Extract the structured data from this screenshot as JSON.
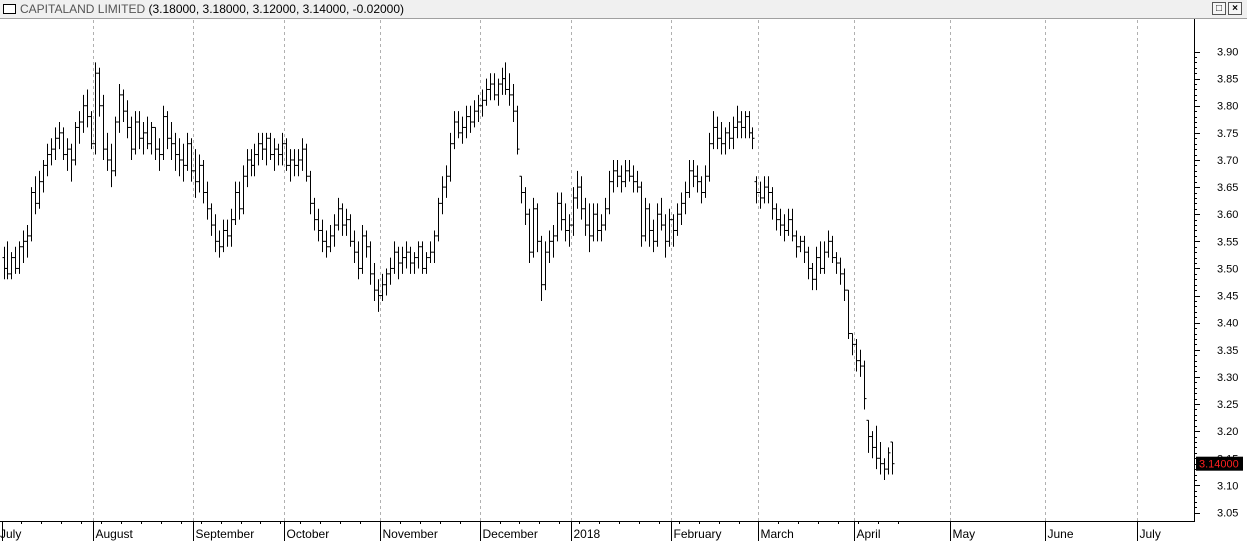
{
  "window": {
    "symbol": "CAPITALAND LIMITED",
    "ohlc": "(3.18000, 3.18000, 3.12000, 3.14000, -0.02000)"
  },
  "chart_data": {
    "type": "ohlc",
    "title": "CAPITALAND LIMITED",
    "xlabel": "",
    "ylabel": "",
    "ylim": [
      3.03,
      3.93
    ],
    "y_ticks": [
      "3.05",
      "3.10",
      "3.15",
      "3.20",
      "3.25",
      "3.30",
      "3.35",
      "3.40",
      "3.45",
      "3.50",
      "3.55",
      "3.60",
      "3.65",
      "3.70",
      "3.75",
      "3.80",
      "3.85",
      "3.90"
    ],
    "x_labels": [
      {
        "label": "July",
        "bar": 0
      },
      {
        "label": "August",
        "bar": 23
      },
      {
        "label": "September",
        "bar": 48
      },
      {
        "label": "October",
        "bar": 71
      },
      {
        "label": "November",
        "bar": 95
      },
      {
        "label": "December",
        "bar": 120
      },
      {
        "label": "2018",
        "bar": 143
      },
      {
        "label": "February",
        "bar": 168
      },
      {
        "label": "March",
        "bar": 190
      },
      {
        "label": "April",
        "bar": 214
      },
      {
        "label": "May",
        "bar": 238
      },
      {
        "label": "June",
        "bar": 262
      },
      {
        "label": "July",
        "bar": 285
      }
    ],
    "grid": {
      "vertical": true,
      "horizontal": false
    },
    "last_price": "3.14000",
    "bars": [
      [
        3.52,
        3.54,
        3.48,
        3.5
      ],
      [
        3.5,
        3.55,
        3.48,
        3.49
      ],
      [
        3.49,
        3.53,
        3.48,
        3.52
      ],
      [
        3.52,
        3.54,
        3.49,
        3.5
      ],
      [
        3.5,
        3.55,
        3.49,
        3.54
      ],
      [
        3.54,
        3.57,
        3.51,
        3.55
      ],
      [
        3.55,
        3.58,
        3.52,
        3.56
      ],
      [
        3.56,
        3.65,
        3.55,
        3.64
      ],
      [
        3.64,
        3.67,
        3.6,
        3.62
      ],
      [
        3.62,
        3.68,
        3.61,
        3.66
      ],
      [
        3.66,
        3.7,
        3.64,
        3.69
      ],
      [
        3.69,
        3.73,
        3.67,
        3.71
      ],
      [
        3.71,
        3.74,
        3.69,
        3.72
      ],
      [
        3.72,
        3.76,
        3.7,
        3.74
      ],
      [
        3.74,
        3.77,
        3.72,
        3.75
      ],
      [
        3.75,
        3.76,
        3.7,
        3.71
      ],
      [
        3.71,
        3.74,
        3.68,
        3.72
      ],
      [
        3.72,
        3.73,
        3.66,
        3.7
      ],
      [
        3.7,
        3.77,
        3.69,
        3.76
      ],
      [
        3.76,
        3.79,
        3.73,
        3.77
      ],
      [
        3.77,
        3.82,
        3.75,
        3.8
      ],
      [
        3.8,
        3.83,
        3.76,
        3.78
      ],
      [
        3.78,
        3.79,
        3.72,
        3.73
      ],
      [
        3.73,
        3.88,
        3.71,
        3.86
      ],
      [
        3.86,
        3.87,
        3.78,
        3.8
      ],
      [
        3.8,
        3.82,
        3.7,
        3.72
      ],
      [
        3.72,
        3.75,
        3.68,
        3.7
      ],
      [
        3.7,
        3.73,
        3.65,
        3.68
      ],
      [
        3.68,
        3.78,
        3.67,
        3.77
      ],
      [
        3.77,
        3.84,
        3.75,
        3.82
      ],
      [
        3.82,
        3.83,
        3.77,
        3.79
      ],
      [
        3.79,
        3.81,
        3.74,
        3.76
      ],
      [
        3.76,
        3.78,
        3.7,
        3.72
      ],
      [
        3.72,
        3.79,
        3.71,
        3.77
      ],
      [
        3.77,
        3.79,
        3.72,
        3.74
      ],
      [
        3.74,
        3.77,
        3.71,
        3.75
      ],
      [
        3.75,
        3.78,
        3.72,
        3.73
      ],
      [
        3.73,
        3.77,
        3.71,
        3.76
      ],
      [
        3.76,
        3.76,
        3.7,
        3.72
      ],
      [
        3.72,
        3.74,
        3.68,
        3.71
      ],
      [
        3.71,
        3.8,
        3.7,
        3.78
      ],
      [
        3.78,
        3.79,
        3.72,
        3.74
      ],
      [
        3.74,
        3.77,
        3.7,
        3.73
      ],
      [
        3.73,
        3.75,
        3.68,
        3.71
      ],
      [
        3.71,
        3.74,
        3.67,
        3.7
      ],
      [
        3.7,
        3.73,
        3.66,
        3.69
      ],
      [
        3.69,
        3.75,
        3.68,
        3.73
      ],
      [
        3.73,
        3.74,
        3.66,
        3.68
      ],
      [
        3.68,
        3.72,
        3.63,
        3.66
      ],
      [
        3.66,
        3.71,
        3.64,
        3.69
      ],
      [
        3.69,
        3.7,
        3.62,
        3.64
      ],
      [
        3.64,
        3.66,
        3.59,
        3.61
      ],
      [
        3.61,
        3.62,
        3.56,
        3.58
      ],
      [
        3.58,
        3.6,
        3.53,
        3.55
      ],
      [
        3.55,
        3.57,
        3.52,
        3.54
      ],
      [
        3.54,
        3.59,
        3.53,
        3.57
      ],
      [
        3.57,
        3.59,
        3.54,
        3.56
      ],
      [
        3.56,
        3.61,
        3.54,
        3.59
      ],
      [
        3.59,
        3.66,
        3.58,
        3.64
      ],
      [
        3.64,
        3.66,
        3.59,
        3.61
      ],
      [
        3.61,
        3.69,
        3.6,
        3.67
      ],
      [
        3.67,
        3.72,
        3.65,
        3.7
      ],
      [
        3.7,
        3.72,
        3.67,
        3.69
      ],
      [
        3.69,
        3.73,
        3.67,
        3.71
      ],
      [
        3.71,
        3.75,
        3.69,
        3.73
      ],
      [
        3.73,
        3.75,
        3.7,
        3.72
      ],
      [
        3.72,
        3.75,
        3.69,
        3.74
      ],
      [
        3.74,
        3.75,
        3.7,
        3.71
      ],
      [
        3.71,
        3.74,
        3.68,
        3.72
      ],
      [
        3.72,
        3.73,
        3.69,
        3.71
      ],
      [
        3.71,
        3.75,
        3.69,
        3.73
      ],
      [
        3.73,
        3.74,
        3.68,
        3.69
      ],
      [
        3.69,
        3.72,
        3.66,
        3.7
      ],
      [
        3.7,
        3.72,
        3.67,
        3.69
      ],
      [
        3.69,
        3.72,
        3.67,
        3.7
      ],
      [
        3.7,
        3.74,
        3.68,
        3.72
      ],
      [
        3.72,
        3.73,
        3.66,
        3.67
      ],
      [
        3.67,
        3.68,
        3.6,
        3.62
      ],
      [
        3.62,
        3.63,
        3.57,
        3.59
      ],
      [
        3.59,
        3.61,
        3.55,
        3.57
      ],
      [
        3.57,
        3.59,
        3.53,
        3.55
      ],
      [
        3.55,
        3.57,
        3.52,
        3.54
      ],
      [
        3.54,
        3.58,
        3.53,
        3.56
      ],
      [
        3.56,
        3.6,
        3.54,
        3.58
      ],
      [
        3.58,
        3.63,
        3.57,
        3.61
      ],
      [
        3.61,
        3.62,
        3.56,
        3.58
      ],
      [
        3.58,
        3.61,
        3.56,
        3.59
      ],
      [
        3.59,
        3.6,
        3.54,
        3.55
      ],
      [
        3.55,
        3.57,
        3.51,
        3.53
      ],
      [
        3.53,
        3.55,
        3.48,
        3.5
      ],
      [
        3.5,
        3.58,
        3.49,
        3.56
      ],
      [
        3.56,
        3.57,
        3.52,
        3.54
      ],
      [
        3.54,
        3.55,
        3.47,
        3.49
      ],
      [
        3.49,
        3.51,
        3.44,
        3.46
      ],
      [
        3.46,
        3.48,
        3.42,
        3.45
      ],
      [
        3.45,
        3.49,
        3.44,
        3.47
      ],
      [
        3.47,
        3.5,
        3.45,
        3.49
      ],
      [
        3.49,
        3.52,
        3.47,
        3.5
      ],
      [
        3.5,
        3.55,
        3.49,
        3.53
      ],
      [
        3.53,
        3.54,
        3.48,
        3.51
      ],
      [
        3.51,
        3.54,
        3.49,
        3.52
      ],
      [
        3.52,
        3.55,
        3.5,
        3.53
      ],
      [
        3.53,
        3.54,
        3.49,
        3.51
      ],
      [
        3.51,
        3.53,
        3.49,
        3.52
      ],
      [
        3.52,
        3.55,
        3.5,
        3.54
      ],
      [
        3.54,
        3.55,
        3.49,
        3.5
      ],
      [
        3.5,
        3.53,
        3.49,
        3.52
      ],
      [
        3.52,
        3.55,
        3.51,
        3.53
      ],
      [
        3.53,
        3.57,
        3.51,
        3.56
      ],
      [
        3.56,
        3.63,
        3.55,
        3.62
      ],
      [
        3.62,
        3.67,
        3.6,
        3.65
      ],
      [
        3.65,
        3.69,
        3.63,
        3.67
      ],
      [
        3.67,
        3.75,
        3.66,
        3.73
      ],
      [
        3.73,
        3.79,
        3.72,
        3.77
      ],
      [
        3.77,
        3.79,
        3.74,
        3.75
      ],
      [
        3.75,
        3.78,
        3.73,
        3.76
      ],
      [
        3.76,
        3.8,
        3.74,
        3.78
      ],
      [
        3.78,
        3.8,
        3.75,
        3.77
      ],
      [
        3.77,
        3.81,
        3.76,
        3.79
      ],
      [
        3.79,
        3.82,
        3.77,
        3.8
      ],
      [
        3.8,
        3.83,
        3.78,
        3.81
      ],
      [
        3.81,
        3.85,
        3.8,
        3.83
      ],
      [
        3.83,
        3.86,
        3.81,
        3.84
      ],
      [
        3.84,
        3.86,
        3.81,
        3.82
      ],
      [
        3.82,
        3.85,
        3.8,
        3.84
      ],
      [
        3.84,
        3.87,
        3.82,
        3.85
      ],
      [
        3.85,
        3.88,
        3.82,
        3.83
      ],
      [
        3.83,
        3.86,
        3.8,
        3.82
      ],
      [
        3.82,
        3.84,
        3.77,
        3.79
      ],
      [
        3.79,
        3.8,
        3.71,
        3.72
      ],
      [
        3.67,
        3.67,
        3.62,
        3.64
      ],
      [
        3.64,
        3.65,
        3.58,
        3.6
      ],
      [
        3.6,
        3.61,
        3.51,
        3.53
      ],
      [
        3.53,
        3.63,
        3.52,
        3.61
      ],
      [
        3.61,
        3.62,
        3.53,
        3.55
      ],
      [
        3.55,
        3.56,
        3.44,
        3.47
      ],
      [
        3.47,
        3.55,
        3.46,
        3.53
      ],
      [
        3.53,
        3.57,
        3.51,
        3.55
      ],
      [
        3.55,
        3.58,
        3.52,
        3.56
      ],
      [
        3.56,
        3.64,
        3.55,
        3.62
      ],
      [
        3.62,
        3.64,
        3.57,
        3.59
      ],
      [
        3.59,
        3.62,
        3.55,
        3.57
      ],
      [
        3.57,
        3.6,
        3.54,
        3.58
      ],
      [
        3.58,
        3.65,
        3.56,
        3.63
      ],
      [
        3.63,
        3.68,
        3.61,
        3.65
      ],
      [
        3.65,
        3.67,
        3.59,
        3.61
      ],
      [
        3.61,
        3.63,
        3.56,
        3.58
      ],
      [
        3.58,
        3.62,
        3.53,
        3.56
      ],
      [
        3.56,
        3.62,
        3.55,
        3.6
      ],
      [
        3.6,
        3.62,
        3.55,
        3.57
      ],
      [
        3.57,
        3.6,
        3.55,
        3.58
      ],
      [
        3.58,
        3.63,
        3.57,
        3.61
      ],
      [
        3.61,
        3.68,
        3.6,
        3.66
      ],
      [
        3.66,
        3.7,
        3.64,
        3.68
      ],
      [
        3.68,
        3.7,
        3.65,
        3.67
      ],
      [
        3.67,
        3.69,
        3.64,
        3.66
      ],
      [
        3.66,
        3.7,
        3.65,
        3.68
      ],
      [
        3.68,
        3.7,
        3.66,
        3.67
      ],
      [
        3.67,
        3.69,
        3.64,
        3.66
      ],
      [
        3.66,
        3.68,
        3.64,
        3.65
      ],
      [
        3.65,
        3.66,
        3.54,
        3.56
      ],
      [
        3.56,
        3.63,
        3.55,
        3.61
      ],
      [
        3.61,
        3.62,
        3.54,
        3.57
      ],
      [
        3.57,
        3.59,
        3.53,
        3.55
      ],
      [
        3.55,
        3.62,
        3.54,
        3.6
      ],
      [
        3.6,
        3.63,
        3.57,
        3.58
      ],
      [
        3.58,
        3.6,
        3.52,
        3.55
      ],
      [
        3.55,
        3.61,
        3.54,
        3.59
      ],
      [
        3.59,
        3.6,
        3.54,
        3.57
      ],
      [
        3.57,
        3.62,
        3.56,
        3.6
      ],
      [
        3.6,
        3.64,
        3.58,
        3.62
      ],
      [
        3.62,
        3.66,
        3.6,
        3.64
      ],
      [
        3.64,
        3.7,
        3.63,
        3.68
      ],
      [
        3.68,
        3.7,
        3.65,
        3.67
      ],
      [
        3.67,
        3.69,
        3.64,
        3.66
      ],
      [
        3.66,
        3.67,
        3.62,
        3.64
      ],
      [
        3.64,
        3.69,
        3.63,
        3.67
      ],
      [
        3.67,
        3.75,
        3.66,
        3.73
      ],
      [
        3.73,
        3.79,
        3.72,
        3.76
      ],
      [
        3.76,
        3.78,
        3.72,
        3.74
      ],
      [
        3.74,
        3.77,
        3.71,
        3.73
      ],
      [
        3.73,
        3.76,
        3.71,
        3.75
      ],
      [
        3.75,
        3.77,
        3.72,
        3.74
      ],
      [
        3.74,
        3.78,
        3.72,
        3.76
      ],
      [
        3.76,
        3.8,
        3.74,
        3.77
      ],
      [
        3.77,
        3.79,
        3.74,
        3.76
      ],
      [
        3.76,
        3.79,
        3.74,
        3.78
      ],
      [
        3.78,
        3.79,
        3.74,
        3.75
      ],
      [
        3.75,
        3.76,
        3.72,
        3.74
      ],
      [
        3.66,
        3.67,
        3.62,
        3.64
      ],
      [
        3.64,
        3.66,
        3.61,
        3.63
      ],
      [
        3.63,
        3.67,
        3.62,
        3.65
      ],
      [
        3.65,
        3.67,
        3.62,
        3.64
      ],
      [
        3.64,
        3.65,
        3.59,
        3.61
      ],
      [
        3.61,
        3.62,
        3.57,
        3.59
      ],
      [
        3.59,
        3.61,
        3.56,
        3.58
      ],
      [
        3.58,
        3.6,
        3.55,
        3.57
      ],
      [
        3.57,
        3.61,
        3.56,
        3.59
      ],
      [
        3.59,
        3.61,
        3.55,
        3.56
      ],
      [
        3.56,
        3.57,
        3.52,
        3.54
      ],
      [
        3.54,
        3.56,
        3.53,
        3.55
      ],
      [
        3.55,
        3.56,
        3.51,
        3.53
      ],
      [
        3.53,
        3.54,
        3.48,
        3.5
      ],
      [
        3.5,
        3.51,
        3.46,
        3.48
      ],
      [
        3.48,
        3.54,
        3.46,
        3.52
      ],
      [
        3.52,
        3.55,
        3.49,
        3.5
      ],
      [
        3.5,
        3.55,
        3.49,
        3.53
      ],
      [
        3.53,
        3.57,
        3.52,
        3.55
      ],
      [
        3.55,
        3.56,
        3.51,
        3.52
      ],
      [
        3.52,
        3.53,
        3.49,
        3.51
      ],
      [
        3.51,
        3.52,
        3.47,
        3.49
      ],
      [
        3.49,
        3.5,
        3.44,
        3.46
      ],
      [
        3.46,
        3.46,
        3.37,
        3.38
      ],
      [
        3.38,
        3.38,
        3.34,
        3.36
      ],
      [
        3.36,
        3.37,
        3.31,
        3.33
      ],
      [
        3.33,
        3.35,
        3.3,
        3.32
      ],
      [
        3.32,
        3.33,
        3.24,
        3.26
      ],
      [
        3.22,
        3.22,
        3.16,
        3.19
      ],
      [
        3.19,
        3.2,
        3.15,
        3.17
      ],
      [
        3.17,
        3.21,
        3.13,
        3.15
      ],
      [
        3.15,
        3.18,
        3.12,
        3.14
      ],
      [
        3.14,
        3.15,
        3.11,
        3.13
      ],
      [
        3.13,
        3.17,
        3.12,
        3.16
      ],
      [
        3.18,
        3.18,
        3.12,
        3.14
      ]
    ]
  }
}
